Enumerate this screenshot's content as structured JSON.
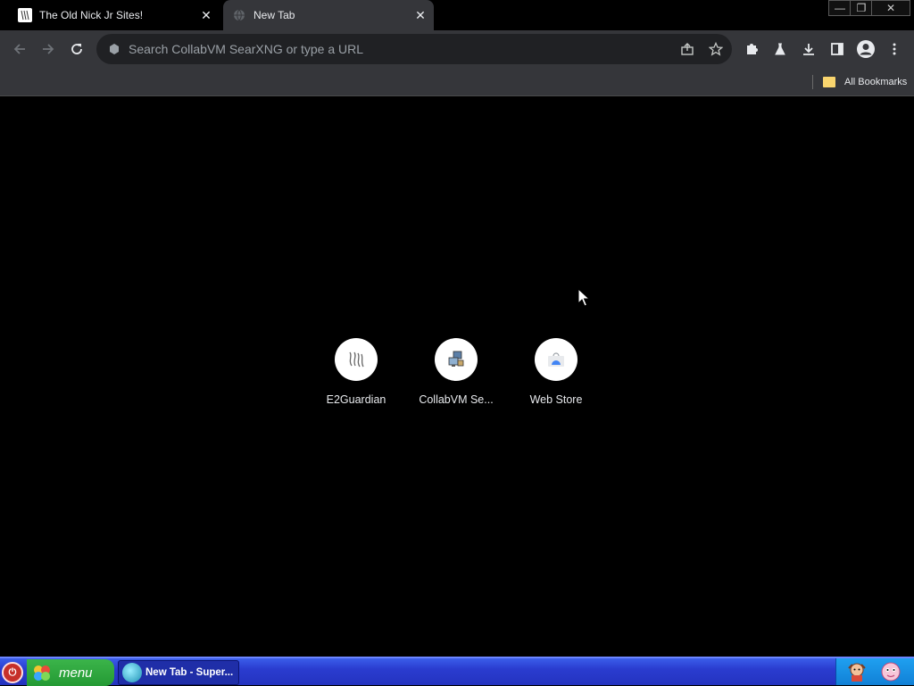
{
  "tabs": [
    {
      "title": "The Old Nick Jr Sites!",
      "close": "✕"
    },
    {
      "title": "New Tab",
      "close": "✕"
    }
  ],
  "window_controls": {
    "minimize": "—",
    "maximize": "❐",
    "close": "✕"
  },
  "omnibox": {
    "placeholder": "Search CollabVM SearXNG or type a URL",
    "value": ""
  },
  "bookmarks": {
    "all_label": "All Bookmarks"
  },
  "shortcuts": [
    {
      "label": "E2Guardian"
    },
    {
      "label": "CollabVM Se..."
    },
    {
      "label": "Web Store"
    }
  ],
  "taskbar": {
    "menu_label": "menu",
    "task_label": "New Tab - Super...",
    "power_glyph": "⏻"
  },
  "icons": {
    "back": "arrow-left-icon",
    "forward": "arrow-right-icon",
    "reload": "reload-icon",
    "share": "share-icon",
    "star": "star-icon",
    "extensions": "puzzle-icon",
    "labs": "flask-icon",
    "download": "download-icon",
    "sidepanel": "side-panel-icon",
    "profile": "profile-icon",
    "more": "kebab-menu-icon"
  },
  "colors": {
    "toolbar": "#35363a",
    "omnibox": "#202124",
    "taskbar": "#2a3ccf",
    "menu_button": "#249a34"
  }
}
